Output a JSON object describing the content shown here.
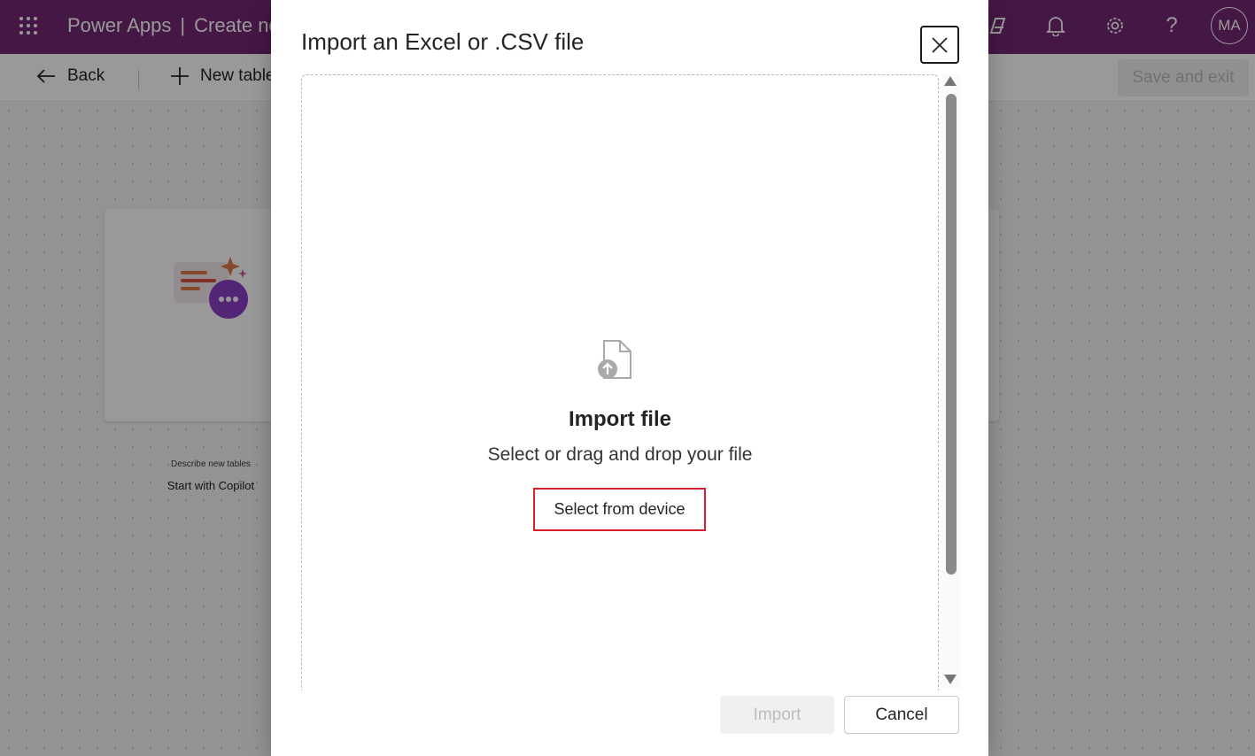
{
  "header": {
    "app_name": "Power Apps",
    "separator": "|",
    "page_title": "Create new tables",
    "avatar_initials": "MA"
  },
  "commandbar": {
    "back_label": "Back",
    "new_table_label": "New table",
    "save_exit_label": "Save and exit"
  },
  "canvas": {
    "copilot_card": {
      "subtitle": "Describe new tables",
      "title": "Start with Copilot"
    }
  },
  "dialog": {
    "title": "Import an Excel or .CSV file",
    "dropzone": {
      "heading": "Import file",
      "subheading": "Select or drag and drop your file",
      "select_button": "Select from device"
    },
    "import_button": "Import",
    "cancel_button": "Cancel"
  },
  "colors": {
    "brand": "#742774",
    "highlight": "#d6202b"
  }
}
